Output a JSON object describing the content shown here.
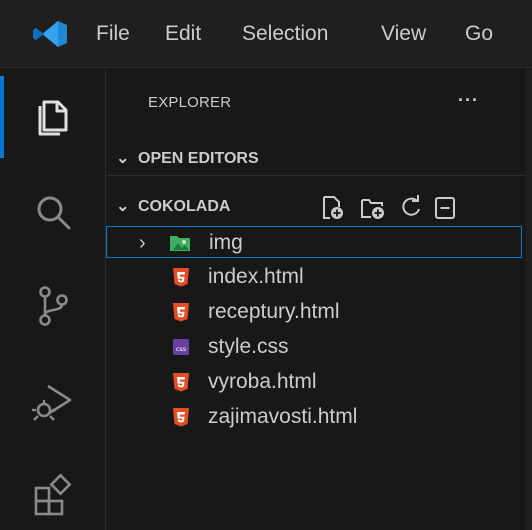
{
  "menu": {
    "items": [
      "File",
      "Edit",
      "Selection",
      "View",
      "Go"
    ]
  },
  "activity_bar": {
    "icons": [
      "explorer-icon",
      "search-icon",
      "source-control-icon",
      "run-debug-icon",
      "extensions-icon"
    ],
    "active": "explorer-icon"
  },
  "explorer": {
    "title": "EXPLORER",
    "more_label": "···",
    "open_editors_label": "OPEN EDITORS",
    "folder_label": "COKOLADA",
    "header_actions": [
      "new-file-icon",
      "new-folder-icon",
      "refresh-icon",
      "collapse-all-icon"
    ]
  },
  "tree": {
    "items": [
      {
        "label": "img",
        "type": "folder",
        "icon": "image-folder-icon",
        "expanded": false,
        "selected": true
      },
      {
        "label": "index.html",
        "type": "file",
        "icon": "html-icon"
      },
      {
        "label": "receptury.html",
        "type": "file",
        "icon": "html-icon"
      },
      {
        "label": "style.css",
        "type": "file",
        "icon": "css-icon"
      },
      {
        "label": "vyroba.html",
        "type": "file",
        "icon": "html-icon"
      },
      {
        "label": "zajimavosti.html",
        "type": "file",
        "icon": "html-icon"
      }
    ]
  },
  "colors": {
    "accent": "#0078d4",
    "html_icon": "#e44d26",
    "css_icon": "#6b3fa0",
    "folder_icon": "#3fae62",
    "background": "#181818"
  }
}
